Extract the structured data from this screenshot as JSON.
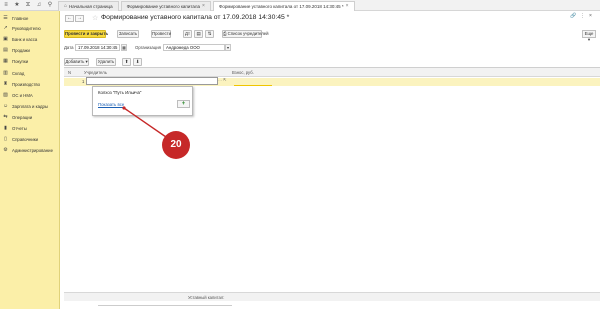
{
  "tabs": {
    "home": "Начальная страница",
    "tab1": "Формирование уставного капитала",
    "tab2": "Формирование уставного капитала от 17.09.2018 14:30:45 *"
  },
  "sidebar": {
    "items": [
      {
        "label": "Главное",
        "icon": "home-icon"
      },
      {
        "label": "Руководителю",
        "icon": "chart-icon"
      },
      {
        "label": "Банк и касса",
        "icon": "bank-icon"
      },
      {
        "label": "Продажи",
        "icon": "sales-icon"
      },
      {
        "label": "Покупки",
        "icon": "cart-icon"
      },
      {
        "label": "Склад",
        "icon": "warehouse-icon"
      },
      {
        "label": "Производство",
        "icon": "factory-icon"
      },
      {
        "label": "ОС и НМА",
        "icon": "assets-icon"
      },
      {
        "label": "Зарплата и кадры",
        "icon": "people-icon"
      },
      {
        "label": "Операции",
        "icon": "operations-icon"
      },
      {
        "label": "Отчеты",
        "icon": "reports-icon"
      },
      {
        "label": "Справочники",
        "icon": "book-icon"
      },
      {
        "label": "Администрирование",
        "icon": "gear-icon"
      }
    ]
  },
  "form": {
    "title": "Формирование уставного капитала от 17.09.2018 14:30:45 *",
    "post_close": "Провести и закрыть",
    "save": "Записать",
    "post": "Провести",
    "founders_list": "Список учредителей",
    "more": "Еще",
    "date_label": "Дата",
    "date_value": "17.09.2018 14:30:45",
    "org_label": "Организация",
    "org_value": "Андромеда ООО"
  },
  "table_toolbar": {
    "add": "Добавить",
    "delete": "Удалить"
  },
  "table": {
    "col_n": "N",
    "col_founder": "Учредитель",
    "col_contribution": "Взнос, руб.",
    "row_num": "1",
    "footer": "Уставный капитал:"
  },
  "dropdown": {
    "item": "Колхоз \"Путь Ильича\"",
    "show_all": "Показать все",
    "add": "+"
  },
  "annotation": {
    "number": "20",
    "color": "#c62828"
  }
}
